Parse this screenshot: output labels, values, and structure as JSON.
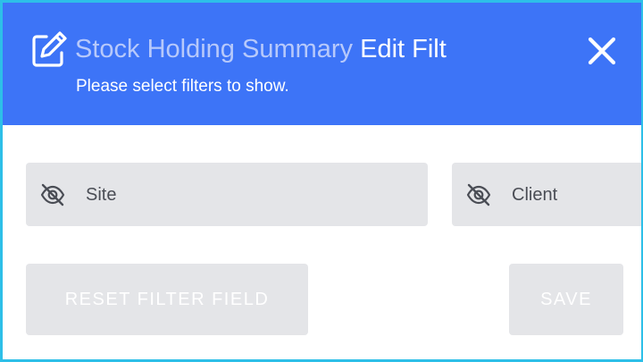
{
  "dialog": {
    "title": "Stock Holding Summary",
    "title_action": "Edit Filt",
    "subtitle": "Please select filters to show.",
    "header_color": "#3d74f7",
    "icons": {
      "edit": "edit-pencil-icon",
      "close": "close-icon",
      "visibility": "eye-off-icon"
    }
  },
  "filters": [
    {
      "label": "Site",
      "visible": false
    },
    {
      "label": "Client",
      "visible": false
    }
  ],
  "actions": {
    "reset_label": "RESET FILTER FIELD",
    "save_label": "SAVE"
  }
}
